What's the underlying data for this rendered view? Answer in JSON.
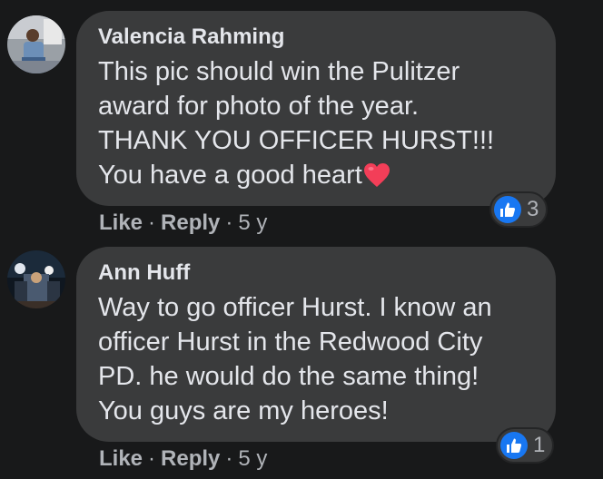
{
  "comments": [
    {
      "author": "Valencia Rahming",
      "text_lines": [
        "This pic should win the Pulitzer",
        "award for photo of the year.",
        "THANK YOU OFFICER HURST!!!",
        "You have a good heart"
      ],
      "emoji": "heart-emoji",
      "reaction_icon": "like-icon",
      "reaction_count": "3",
      "like_label": "Like",
      "reply_label": "Reply",
      "separator": "·",
      "time": "5 y"
    },
    {
      "author": "Ann Huff",
      "text_lines": [
        "Way to go officer Hurst. I know an",
        "officer Hurst in the Redwood City",
        "PD. he would do the same thing!",
        "You guys are my heroes!"
      ],
      "reaction_icon": "like-icon",
      "reaction_count": "1",
      "like_label": "Like",
      "reply_label": "Reply",
      "separator": "·",
      "time": "5 y"
    }
  ],
  "colors": {
    "background": "#18191a",
    "bubble": "#3a3b3c",
    "primary_text": "#e4e6eb",
    "secondary_text": "#b0b3b8",
    "like_blue": "#1877f2",
    "heart_red": "#f33e58"
  }
}
